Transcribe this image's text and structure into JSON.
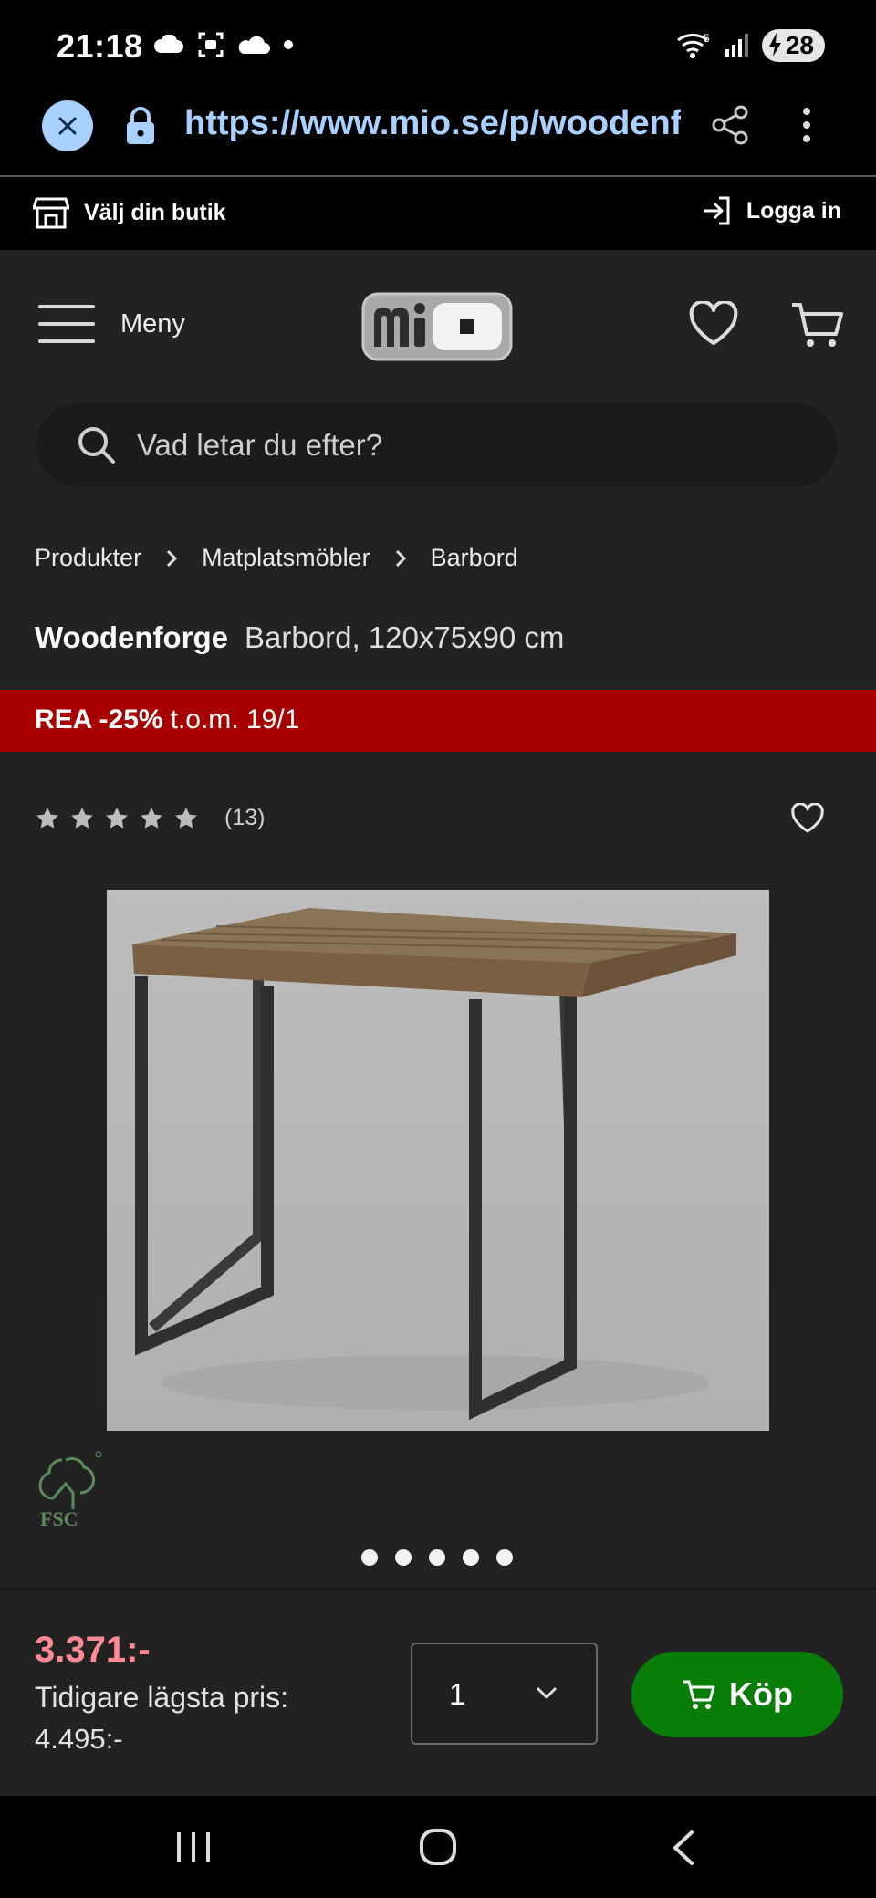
{
  "status_bar": {
    "time": "21:18",
    "battery": "28",
    "icons_left": [
      "cloud-icon",
      "screenshot-icon",
      "app-icon",
      "dot-icon"
    ],
    "icons_right": [
      "wifi-icon",
      "signal-icon",
      "battery-icon"
    ]
  },
  "browser": {
    "url": "https://www.mio.se/p/woodenforge-barbord",
    "icons": [
      "close-icon",
      "lock-icon",
      "share-icon",
      "more-vert-icon"
    ]
  },
  "top_links": {
    "store": "Välj din butik",
    "login": "Logga in"
  },
  "header": {
    "menu_label": "Meny",
    "logo": "mio",
    "icons": [
      "hamburger-icon",
      "heart-icon",
      "cart-icon"
    ]
  },
  "search": {
    "placeholder": "Vad letar du efter?"
  },
  "breadcrumb": [
    "Produkter",
    "Matplatsmöbler",
    "Barbord"
  ],
  "product": {
    "brand": "Woodenforge",
    "name": "Barbord, 120x75x90 cm",
    "rating_stars": 5,
    "review_count": "(13)",
    "certification": "FSC",
    "image_count": 5,
    "active_image": 1
  },
  "sale_banner": {
    "label": "REA -25%",
    "period": "t.o.m. 19/1"
  },
  "purchase": {
    "price": "3.371:-",
    "previous_label": "Tidigare lägsta pris:",
    "previous_value": "4.495:-",
    "quantity": "1",
    "buy_label": "Köp"
  },
  "colors": {
    "accent_url": "#a8d1ff",
    "sale_red": "#a60000",
    "price_pink": "#ff8a95",
    "buy_green": "#087d08"
  }
}
